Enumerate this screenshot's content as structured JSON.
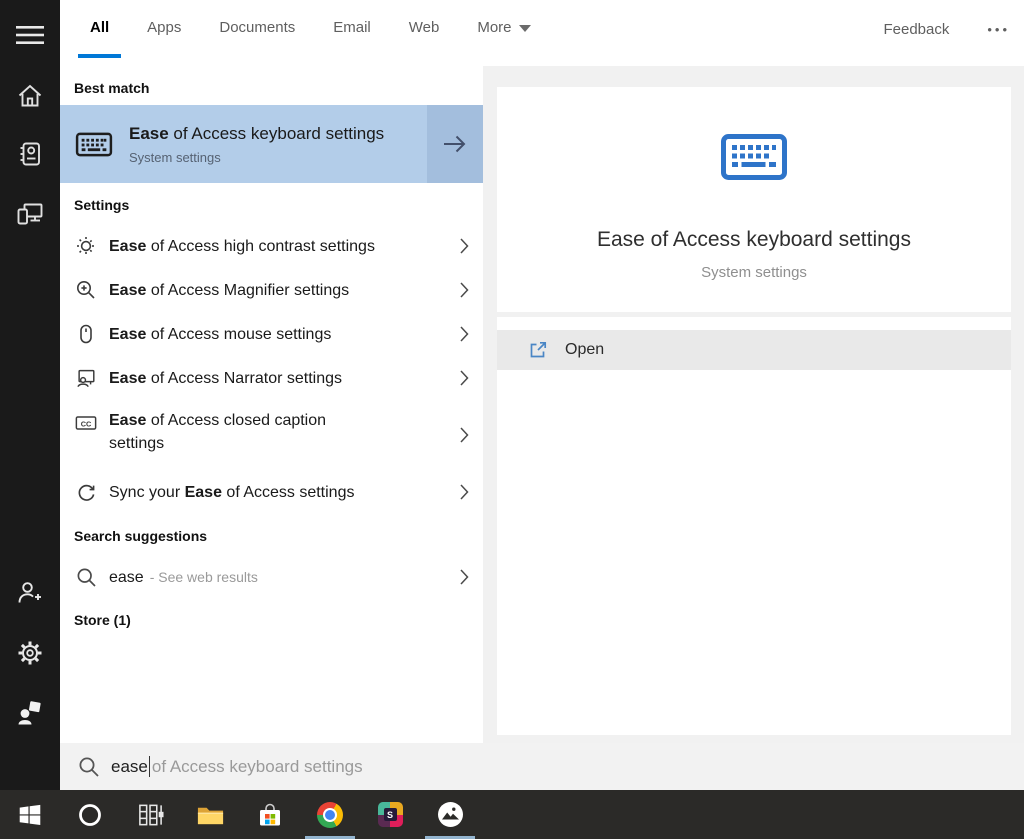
{
  "colors": {
    "accent": "#0078d7",
    "sidebar_bg": "#1a1a1a",
    "taskbar_bg": "#2b2a28",
    "best_match_bg": "#b3cde9",
    "best_match_arrow_bg": "#a3bedd",
    "open_row_bg": "#e9e9e9",
    "panel_bg": "#f1f1f1",
    "preview_icon_blue": "#2e74c9",
    "running_indicator": "#93b4cf"
  },
  "tab_bar": {
    "tabs": [
      {
        "label": "All",
        "active": true
      },
      {
        "label": "Apps",
        "active": false
      },
      {
        "label": "Documents",
        "active": false
      },
      {
        "label": "Email",
        "active": false
      },
      {
        "label": "Web",
        "active": false
      },
      {
        "label": "More",
        "active": false,
        "dropdown": true
      }
    ],
    "feedback_label": "Feedback",
    "overflow_label": "•••"
  },
  "sidebar": {
    "icons": [
      "hamburger-menu-icon",
      "home-icon",
      "notebook-icon",
      "devices-icon",
      "add-user-icon",
      "settings-gear-icon",
      "photos-person-icon"
    ]
  },
  "results": {
    "best_match": {
      "header": "Best match",
      "item": {
        "icon": "keyboard-icon",
        "bold": "Ease",
        "post": " of Access keyboard settings",
        "subtitle": "System settings"
      }
    },
    "settings": {
      "header": "Settings",
      "items": [
        {
          "icon": "high-contrast-icon",
          "pre": "",
          "bold": "Ease",
          "post": " of Access high contrast settings"
        },
        {
          "icon": "magnifier-plus-icon",
          "pre": "",
          "bold": "Ease",
          "post": " of Access Magnifier settings"
        },
        {
          "icon": "mouse-icon",
          "pre": "",
          "bold": "Ease",
          "post": " of Access mouse settings"
        },
        {
          "icon": "narrator-icon",
          "pre": "",
          "bold": "Ease",
          "post": " of Access Narrator settings"
        },
        {
          "icon": "closed-caption-icon",
          "pre": "",
          "bold": "Ease",
          "post": " of Access closed caption settings"
        },
        {
          "icon": "sync-icon",
          "pre": "Sync your ",
          "bold": "Ease",
          "post": " of Access settings"
        }
      ]
    },
    "suggestions": {
      "header": "Search suggestions",
      "items": [
        {
          "icon": "search-icon",
          "query": "ease",
          "hint": "- See web results"
        }
      ]
    },
    "store_header": "Store (1)"
  },
  "preview": {
    "icon": "keyboard-icon",
    "title": "Ease of Access keyboard settings",
    "subtitle": "System settings",
    "open_label": "Open",
    "open_icon": "open-external-icon"
  },
  "search_bar": {
    "icon": "search-icon",
    "typed": "ease",
    "ghost": "of Access keyboard settings"
  },
  "taskbar": {
    "buttons": [
      {
        "name": "start-button",
        "icon": "windows-logo-icon",
        "running": false
      },
      {
        "name": "cortana-button",
        "icon": "cortana-circle-icon",
        "running": false
      },
      {
        "name": "task-view-button",
        "icon": "task-view-icon",
        "running": false
      },
      {
        "name": "file-explorer-button",
        "icon": "folder-icon",
        "running": false
      },
      {
        "name": "store-button",
        "icon": "store-bag-icon",
        "running": false
      },
      {
        "name": "chrome-button",
        "icon": "chrome-icon",
        "running": true
      },
      {
        "name": "slack-button",
        "icon": "slack-icon",
        "running": false
      },
      {
        "name": "photos-button",
        "icon": "photos-icon",
        "running": true
      }
    ]
  }
}
